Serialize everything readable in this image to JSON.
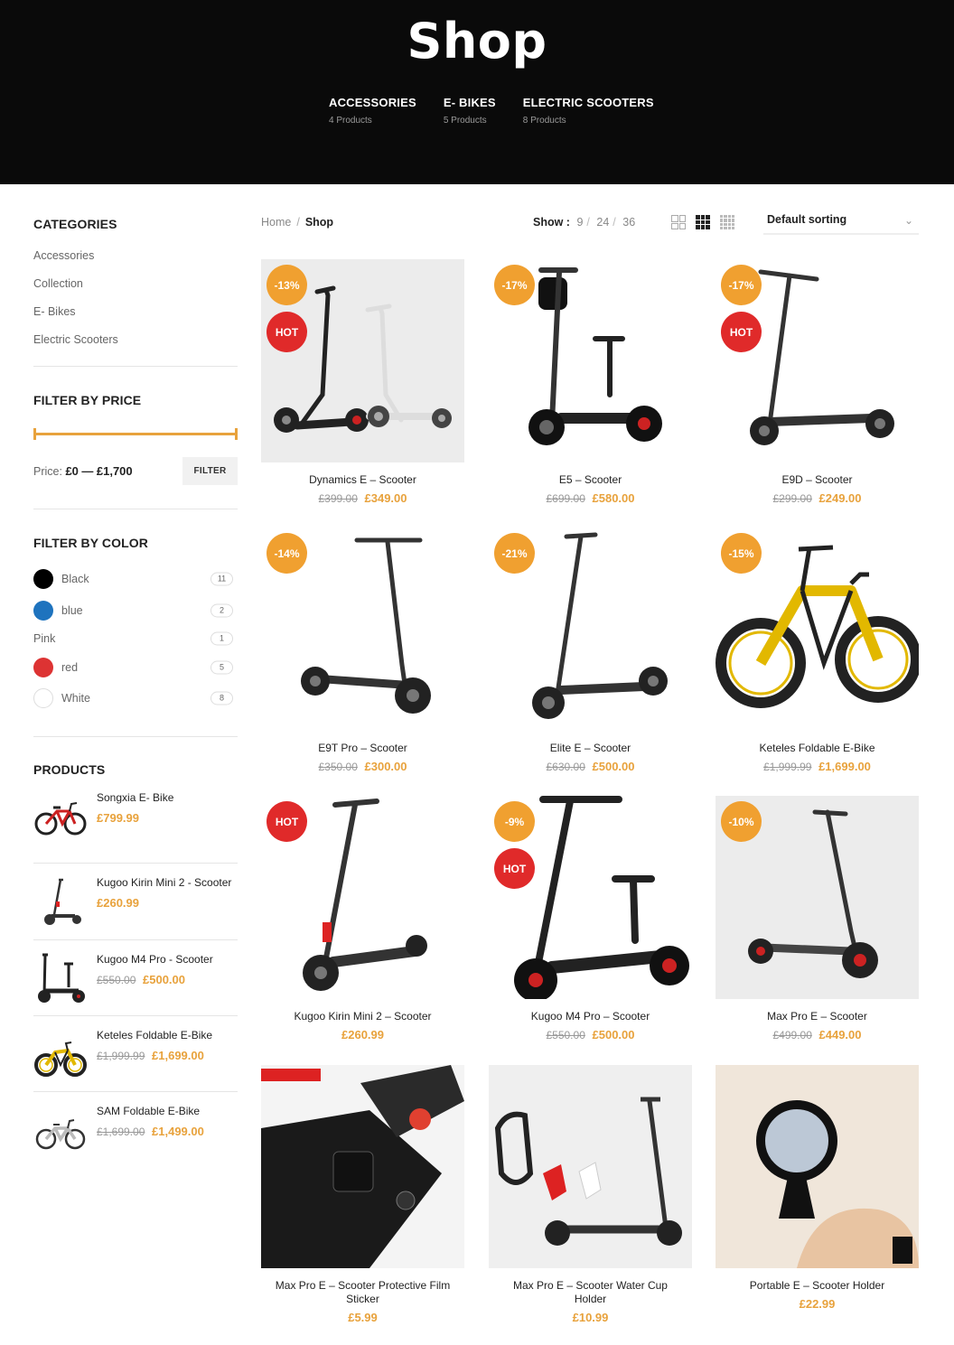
{
  "header": {
    "title": "Shop",
    "categories": [
      {
        "name": "ACCESSORIES",
        "count": "4 Products"
      },
      {
        "name": "E- BIKES",
        "count": "5 Products"
      },
      {
        "name": "ELECTRIC SCOOTERS",
        "count": "8 Products"
      }
    ]
  },
  "sidebar": {
    "categories_title": "CATEGORIES",
    "categories": [
      "Accessories",
      "Collection",
      "E- Bikes",
      "Electric Scooters"
    ],
    "price_title": "FILTER BY PRICE",
    "price_label": "Price:",
    "price_min": "£0",
    "price_dash": "—",
    "price_max": "£1,700",
    "filter_button": "FILTER",
    "color_title": "FILTER BY COLOR",
    "colors": [
      {
        "name": "Black",
        "count": "11",
        "swatch": "#000000"
      },
      {
        "name": "blue",
        "count": "2",
        "swatch": "#1e73be"
      },
      {
        "name": "Pink",
        "count": "1",
        "swatch": ""
      },
      {
        "name": "red",
        "count": "5",
        "swatch": "#dd3333"
      },
      {
        "name": "White",
        "count": "8",
        "swatch": "#ffffff"
      }
    ],
    "products_title": "PRODUCTS",
    "products": [
      {
        "name": "Songxia E- Bike",
        "old_price": "",
        "price": "£799.99",
        "icon": "ebike-red-icon"
      },
      {
        "name": "Kugoo Kirin Mini 2 - Scooter",
        "old_price": "",
        "price": "£260.99",
        "icon": "scooter-red-icon"
      },
      {
        "name": "Kugoo M4 Pro - Scooter",
        "old_price": "£550.00",
        "price": "£500.00",
        "icon": "scooter-seat-icon"
      },
      {
        "name": "Keteles Foldable E-Bike",
        "old_price": "£1,999.99",
        "price": "£1,699.00",
        "icon": "ebike-yellow-icon"
      },
      {
        "name": "SAM Foldable E-Bike",
        "old_price": "£1,699.00",
        "price": "£1,499.00",
        "icon": "ebike-white-icon"
      }
    ]
  },
  "toolbar": {
    "breadcrumb_home": "Home",
    "breadcrumb_sep": "/",
    "breadcrumb_current": "Shop",
    "show_label": "Show :",
    "show_options": [
      "9",
      "24",
      "36"
    ],
    "sorting": "Default sorting"
  },
  "products": [
    {
      "name": "Dynamics E – Scooter",
      "old_price": "£399.00",
      "price": "£349.00",
      "sale": "-13%",
      "hot": "HOT",
      "image": "scooter-pair-icon"
    },
    {
      "name": "E5 – Scooter",
      "old_price": "£699.00",
      "price": "£580.00",
      "sale": "-17%",
      "hot": "",
      "image": "scooter-seat-icon"
    },
    {
      "name": "E9D – Scooter",
      "old_price": "£299.00",
      "price": "£249.00",
      "sale": "-17%",
      "hot": "HOT",
      "image": "scooter-icon"
    },
    {
      "name": "E9T Pro – Scooter",
      "old_price": "£350.00",
      "price": "£300.00",
      "sale": "-14%",
      "hot": "",
      "image": "scooter-icon"
    },
    {
      "name": "Elite E – Scooter",
      "old_price": "£630.00",
      "price": "£500.00",
      "sale": "-21%",
      "hot": "",
      "image": "scooter-icon"
    },
    {
      "name": "Keteles Foldable E-Bike",
      "old_price": "£1,999.99",
      "price": "£1,699.00",
      "sale": "-15%",
      "hot": "",
      "image": "fatbike-icon"
    },
    {
      "name": "Kugoo Kirin Mini 2 – Scooter",
      "old_price": "",
      "price": "£260.99",
      "sale": "",
      "hot": "HOT",
      "image": "scooter-red-icon"
    },
    {
      "name": "Kugoo M4 Pro – Scooter",
      "old_price": "£550.00",
      "price": "£500.00",
      "sale": "-9%",
      "hot": "HOT",
      "image": "scooter-seat-icon"
    },
    {
      "name": "Max Pro E – Scooter",
      "old_price": "£499.00",
      "price": "£449.00",
      "sale": "-10%",
      "hot": "",
      "image": "scooter-icon"
    },
    {
      "name": "Max Pro E – Scooter Protective Film Sticker",
      "old_price": "",
      "price": "£5.99",
      "sale": "",
      "hot": "",
      "image": "sticker-icon"
    },
    {
      "name": "Max Pro E – Scooter Water Cup Holder",
      "old_price": "",
      "price": "£10.99",
      "sale": "",
      "hot": "",
      "image": "cup-holder-icon"
    },
    {
      "name": "Portable E – Scooter Holder",
      "old_price": "",
      "price": "£22.99",
      "sale": "",
      "hot": "",
      "image": "mirror-icon"
    }
  ],
  "colors": {
    "accent": "#e8a23c",
    "sale_badge": "#f0a030",
    "hot_badge": "#e02a2a",
    "header_bg": "#0a0a0a"
  }
}
